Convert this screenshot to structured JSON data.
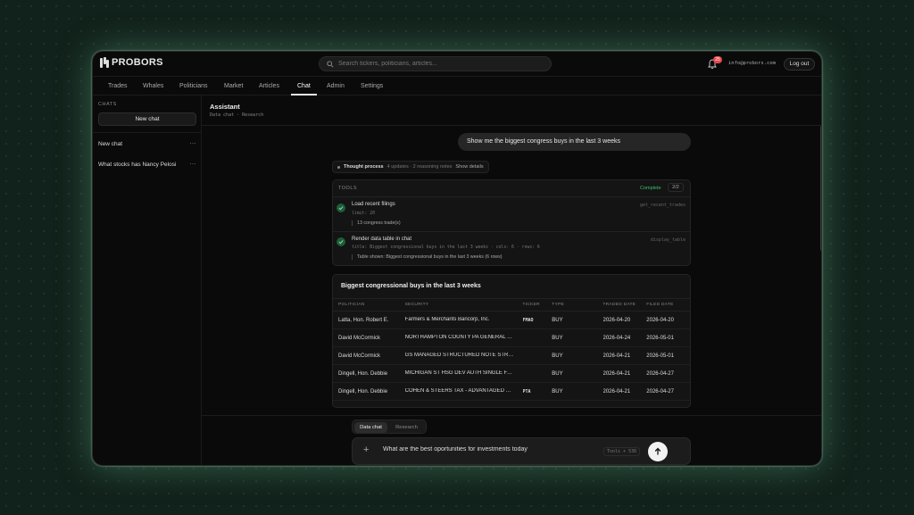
{
  "brand": {
    "name": "PROBORS"
  },
  "search": {
    "placeholder": "Search tickers, politicians, articles..."
  },
  "header": {
    "notification_count": "25",
    "email": "info@probors.com",
    "logout_label": "Log out"
  },
  "nav": {
    "tabs": [
      {
        "label": "Trades"
      },
      {
        "label": "Whales"
      },
      {
        "label": "Politicians"
      },
      {
        "label": "Market"
      },
      {
        "label": "Articles"
      },
      {
        "label": "Chat",
        "active": true
      },
      {
        "label": "Admin"
      },
      {
        "label": "Settings"
      }
    ]
  },
  "sidebar": {
    "section_label": "CHATS",
    "new_chat_label": "New chat",
    "items": [
      {
        "title": "New chat",
        "menu": "⋯"
      },
      {
        "title": "What stocks has Nancy Pelosi",
        "menu": "⋯"
      }
    ]
  },
  "assistant": {
    "title": "Assistant",
    "subtitle": "Data chat · Research"
  },
  "conversation": {
    "user_message": "Show me the biggest congress buys in the last 3 weeks",
    "thought": {
      "label": "Thought process",
      "meta": "4 updates · 2 reasoning notes",
      "toggle": "Show details"
    },
    "tools": {
      "label": "TOOLS",
      "status": "Complete",
      "count": "2/2",
      "calls": [
        {
          "name": "Load recent filings",
          "function": "get_recent_trades",
          "args": "limit: 20",
          "output": "13 congress trade(s)"
        },
        {
          "name": "Render data table in chat",
          "function": "display_table",
          "args": "title: Biggest congressional buys in the last 3 weeks · cols: 6 · rows: 6",
          "output": "Table shown: Biggest congressional buys in the last 3 weeks (6 rows)"
        }
      ]
    },
    "table": {
      "title": "Biggest congressional buys in the last 3 weeks",
      "columns": [
        "POLITICIAN",
        "SECURITY",
        "TICKER",
        "TYPE",
        "TRADED DATE",
        "FILED DATE"
      ],
      "rows": [
        {
          "politician": "Latta, Hon. Robert E.",
          "security": "Farmers & Merchants Bancorp, Inc.",
          "ticker": "FMAO",
          "type": "BUY",
          "traded": "2026-04-20",
          "filed": "2026-04-20"
        },
        {
          "politician": "David McCormick",
          "security": "NORTHAMPTON COUNTY PA GENERAL PURPOSE",
          "ticker": "",
          "type": "BUY",
          "traded": "2026-04-24",
          "filed": "2026-05-01"
        },
        {
          "politician": "David McCormick",
          "security": "GS MANAGED STRUCTURED NOTE STRATEGY",
          "ticker": "",
          "type": "BUY",
          "traded": "2026-04-21",
          "filed": "2026-05-01"
        },
        {
          "politician": "Dingell, Hon. Debbie",
          "security": "MICHIGAN ST HSG DEV AUTH SINGLE FAMILY",
          "ticker": "",
          "type": "BUY",
          "traded": "2026-04-21",
          "filed": "2026-04-27"
        },
        {
          "politician": "Dingell, Hon. Debbie",
          "security": "COHEN & STEERS TAX - ADVANTAGED PREFERRED",
          "ticker": "PTA",
          "type": "BUY",
          "traded": "2026-04-21",
          "filed": "2026-04-27"
        }
      ]
    }
  },
  "composer": {
    "modes": [
      {
        "label": "Data chat",
        "active": true
      },
      {
        "label": "Research",
        "active": false
      }
    ],
    "plus": "+",
    "value": "What are the best oportunities for investments today",
    "shortcut": "Tools + 536"
  },
  "colors": {
    "accent_green": "#3fbf6f",
    "badge_red": "#e5484d",
    "background": "#0a0a0a"
  },
  "icons": {
    "search": "search-icon",
    "bell": "bell-icon",
    "check": "check-icon",
    "send": "arrow-up-icon",
    "logo": "probors-logo-icon"
  }
}
